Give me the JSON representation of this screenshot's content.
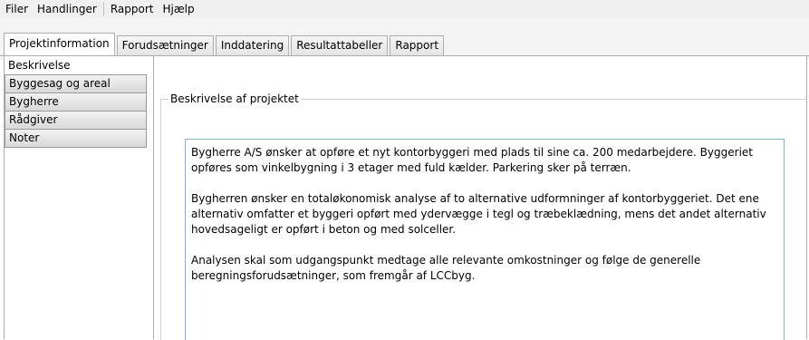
{
  "menubar": {
    "items": [
      "Filer",
      "Handlinger",
      "Rapport",
      "Hjælp"
    ]
  },
  "tabs": [
    {
      "label": "Projektinformation",
      "active": true
    },
    {
      "label": "Forudsætninger",
      "active": false
    },
    {
      "label": "Inddatering",
      "active": false
    },
    {
      "label": "Resultattabeller",
      "active": false
    },
    {
      "label": "Rapport",
      "active": false
    }
  ],
  "sidebar": {
    "items": [
      {
        "label": "Beskrivelse",
        "active": true
      },
      {
        "label": "Byggesag og areal",
        "active": false
      },
      {
        "label": "Bygherre",
        "active": false
      },
      {
        "label": "Rådgiver",
        "active": false
      },
      {
        "label": "Noter",
        "active": false
      }
    ]
  },
  "description": {
    "group_title": "Beskrivelse af projektet",
    "paragraphs": [
      "Bygherre A/S ønsker at opføre et nyt kontorbyggeri med plads til sine ca. 200 medarbejdere. Byggeriet opføres som vinkelbygning i 3 etager med fuld kælder. Parkering sker på terræn.",
      "Bygherren ønsker en totaløkonomisk analyse af to alternative udformninger af kontorbyggeriet. Det ene alternativ omfatter et byggeri opført med ydervægge i tegl og træbeklædning, mens det andet alternativ hovedsageligt er opført i beton og med solceller.",
      "Analysen skal som udgangspunkt medtage alle relevante omkostninger og følge de generelle beregningsforudsætninger, som fremgår af LCCbyg."
    ]
  }
}
